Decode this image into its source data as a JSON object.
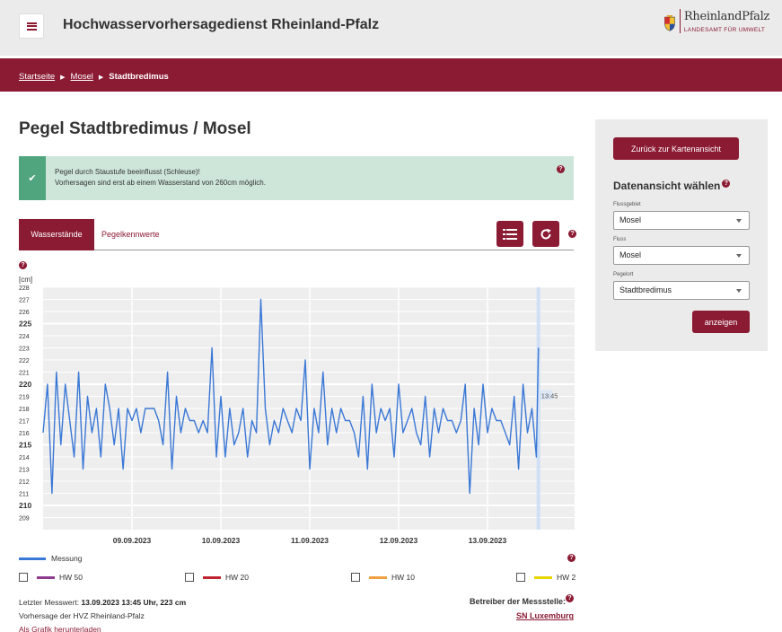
{
  "header": {
    "site_title": "Hochwasservorhersagedienst Rheinland-Pfalz",
    "menu_icon": "hamburger-menu-icon",
    "logo": {
      "line1": "RheinlandPfalz",
      "line2": "LANDESAMT FÜR UMWELT"
    }
  },
  "breadcrumb": {
    "items": [
      "Startseite",
      "Mosel"
    ],
    "current": "Stadtbredimus"
  },
  "page": {
    "title": "Pegel Stadtbredimus / Mosel"
  },
  "notice": {
    "line1": "Pegel durch Staustufe beeinflusst (Schleuse)!",
    "line2": "Vorhersagen sind erst ab einem Wasserstand von 260cm möglich.",
    "icon": "check-icon"
  },
  "tabs": {
    "active": "Wasserstände",
    "inactive": "Pegelkennwerte"
  },
  "toolbar": {
    "list_icon": "list-icon",
    "reload_icon": "reload-icon"
  },
  "help_label": "?",
  "chart_data": {
    "type": "line",
    "ylabel": "[cm]",
    "ylim": [
      208,
      228
    ],
    "yticks": [
      {
        "v": 228,
        "major": false
      },
      {
        "v": 227,
        "major": false
      },
      {
        "v": 226,
        "major": false
      },
      {
        "v": 225,
        "major": true
      },
      {
        "v": 224,
        "major": false
      },
      {
        "v": 223,
        "major": false
      },
      {
        "v": 222,
        "major": false
      },
      {
        "v": 221,
        "major": false
      },
      {
        "v": 220,
        "major": true
      },
      {
        "v": 219,
        "major": false
      },
      {
        "v": 218,
        "major": false
      },
      {
        "v": 217,
        "major": false
      },
      {
        "v": 216,
        "major": false
      },
      {
        "v": 215,
        "major": true
      },
      {
        "v": 214,
        "major": false
      },
      {
        "v": 213,
        "major": false
      },
      {
        "v": 212,
        "major": false
      },
      {
        "v": 211,
        "major": false
      },
      {
        "v": 210,
        "major": true
      },
      {
        "v": 209,
        "major": false
      }
    ],
    "xlim": [
      8.0,
      13.98
    ],
    "xticks": [
      {
        "label": "09.09.2023",
        "x": 9.0
      },
      {
        "label": "10.09.2023",
        "x": 10.0
      },
      {
        "label": "11.09.2023",
        "x": 11.0
      },
      {
        "label": "12.09.2023",
        "x": 12.0
      },
      {
        "label": "13.09.2023",
        "x": 13.0
      }
    ],
    "grid": true,
    "current_marker": {
      "x": 13.573,
      "label": "13:45"
    },
    "series": [
      {
        "name": "Messung",
        "color": "#3a78d6",
        "x": [
          8.0,
          8.05,
          8.1,
          8.15,
          8.2,
          8.25,
          8.3,
          8.35,
          8.4,
          8.45,
          8.5,
          8.55,
          8.6,
          8.65,
          8.7,
          8.75,
          8.8,
          8.85,
          8.9,
          8.95,
          9.0,
          9.05,
          9.1,
          9.15,
          9.2,
          9.25,
          9.3,
          9.35,
          9.4,
          9.45,
          9.5,
          9.55,
          9.6,
          9.65,
          9.7,
          9.75,
          9.8,
          9.85,
          9.9,
          9.95,
          10.0,
          10.05,
          10.1,
          10.15,
          10.2,
          10.25,
          10.3,
          10.35,
          10.4,
          10.45,
          10.5,
          10.55,
          10.6,
          10.65,
          10.7,
          10.75,
          10.8,
          10.85,
          10.9,
          10.95,
          11.0,
          11.05,
          11.1,
          11.15,
          11.2,
          11.25,
          11.3,
          11.35,
          11.4,
          11.45,
          11.5,
          11.55,
          11.6,
          11.65,
          11.7,
          11.75,
          11.8,
          11.85,
          11.9,
          11.95,
          12.0,
          12.05,
          12.1,
          12.15,
          12.2,
          12.25,
          12.3,
          12.35,
          12.4,
          12.45,
          12.5,
          12.55,
          12.6,
          12.65,
          12.7,
          12.75,
          12.8,
          12.85,
          12.9,
          12.95,
          13.0,
          13.05,
          13.1,
          13.15,
          13.2,
          13.25,
          13.3,
          13.35,
          13.4,
          13.45,
          13.5,
          13.55,
          13.573
        ],
        "values": [
          216,
          220,
          211,
          221,
          215,
          220,
          217,
          214,
          221,
          213,
          219,
          216,
          218,
          214,
          220,
          218,
          215,
          218,
          213,
          218,
          217,
          218,
          216,
          218,
          218,
          218,
          217,
          215,
          221,
          213,
          219,
          216,
          218,
          217,
          217,
          216,
          217,
          216,
          223,
          214,
          219,
          214,
          218,
          215,
          216,
          218,
          214,
          217,
          216,
          227,
          218,
          215,
          217,
          216,
          218,
          217,
          216,
          218,
          217,
          222,
          213,
          218,
          216,
          221,
          215,
          218,
          216,
          218,
          217,
          217,
          216,
          214,
          219,
          213,
          220,
          216,
          218,
          217,
          218,
          214,
          220,
          216,
          217,
          218,
          216,
          215,
          219,
          214,
          218,
          216,
          218,
          217,
          217,
          216,
          217,
          220,
          211,
          218,
          215,
          220,
          216,
          218,
          217,
          217,
          216,
          215,
          219,
          213,
          220,
          216,
          218,
          214,
          223
        ]
      }
    ]
  },
  "legend": {
    "messung": "Messung"
  },
  "hw_levels": [
    {
      "label": "HW 50",
      "color": "#8e3a8e"
    },
    {
      "label": "HW 20",
      "color": "#c0242f"
    },
    {
      "label": "HW 10",
      "color": "#f0a040"
    },
    {
      "label": "HW 2",
      "color": "#e8d400"
    }
  ],
  "footer": {
    "last_label": "Letzter Messwert: ",
    "last_value": "13.09.2023 13:45 Uhr, 223 cm",
    "forecast": "Vorhersage der HVZ Rheinland-Pfalz",
    "download": "Als Grafik herunterladen",
    "operator_label": "Betreiber der Messstelle:",
    "operator": "SN Luxemburg"
  },
  "side": {
    "back_button": "Zurück zur Kartenansicht",
    "heading": "Datenansicht wählen",
    "fields": [
      {
        "label": "Flussgebiet",
        "value": "Mosel"
      },
      {
        "label": "Fluss",
        "value": "Mosel"
      },
      {
        "label": "Pegelort",
        "value": "Stadtbredimus"
      }
    ],
    "show_button": "anzeigen"
  }
}
